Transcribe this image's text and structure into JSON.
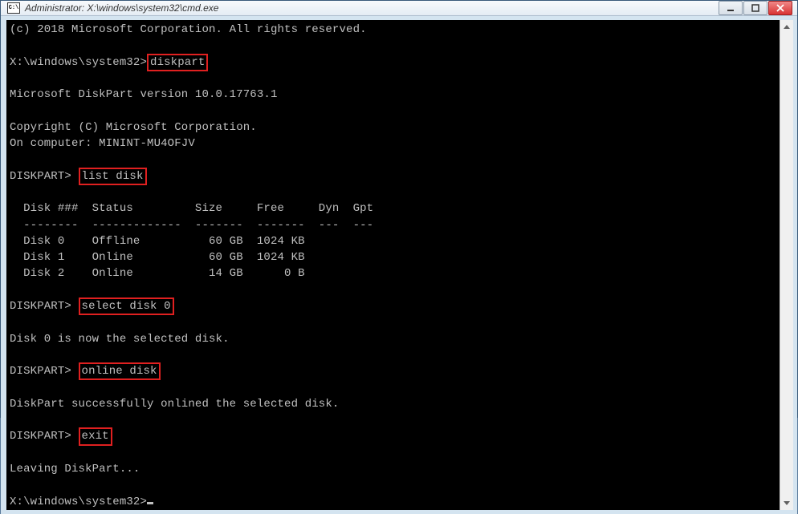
{
  "window": {
    "title": "Administrator: X:\\windows\\system32\\cmd.exe",
    "icon_label": "CMD"
  },
  "terminal": {
    "copyright": "(c) 2018 Microsoft Corporation. All rights reserved.",
    "prompt1_path": "X:\\windows\\system32>",
    "cmd1": "diskpart",
    "dp_version": "Microsoft DiskPart version 10.0.17763.1",
    "dp_copyright": "Copyright (C) Microsoft Corporation.",
    "dp_computer": "On computer: MININT-MU4OFJV",
    "dp_prompt": "DISKPART>",
    "cmd2": "list disk",
    "table_header": "  Disk ###  Status         Size     Free     Dyn  Gpt",
    "table_divider": "  --------  -------------  -------  -------  ---  ---",
    "row0": "  Disk 0    Offline          60 GB  1024 KB",
    "row1": "  Disk 1    Online           60 GB  1024 KB",
    "row2": "  Disk 2    Online           14 GB      0 B",
    "cmd3": "select disk 0",
    "msg_selected": "Disk 0 is now the selected disk.",
    "cmd4": "online disk",
    "msg_onlined": "DiskPart successfully onlined the selected disk.",
    "cmd5": "exit",
    "msg_leaving": "Leaving DiskPart...",
    "prompt_final": "X:\\windows\\system32>"
  }
}
